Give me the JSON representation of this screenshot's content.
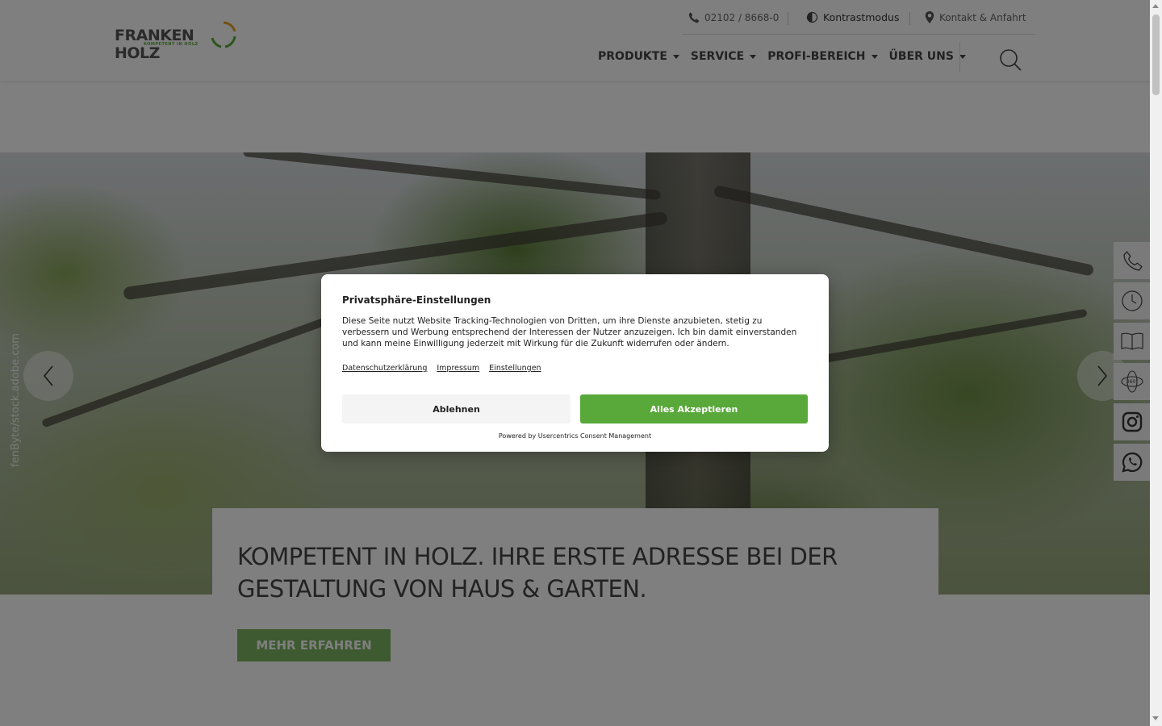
{
  "brand": {
    "name": "FRANKEN HOLZ",
    "tagline": "KOMPETENT IN HOLZ"
  },
  "topbar": {
    "phone": "02102 / 8668-0",
    "contrast": "Kontrastmodus",
    "contact": "Kontakt & Anfahrt"
  },
  "nav": {
    "items": [
      "PRODUKTE",
      "SERVICE",
      "PROFI-BEREICH",
      "ÜBER UNS"
    ]
  },
  "hero": {
    "photo_credit": "fenByte/stock.adobe.com",
    "headline": "KOMPETENT IN HOLZ. IHRE ERSTE ADRESSE BEI DER GESTALTUNG VON HAUS & GARTEN.",
    "cta": "MEHR ERFAHREN"
  },
  "side_icons": [
    "phone-icon",
    "clock-icon",
    "book-icon",
    "360-icon",
    "instagram-icon",
    "whatsapp-icon"
  ],
  "side_360_label": "360°",
  "consent": {
    "title": "Privatsphäre-Einstellungen",
    "text": "Diese Seite nutzt Website Tracking-Technologien von Dritten, um ihre Dienste anzubieten, stetig zu verbessern und Werbung entsprechend der Interessen der Nutzer anzuzeigen. Ich bin damit einverstanden und kann meine Einwilligung jederzeit mit Wirkung für die Zukunft widerrufen oder ändern.",
    "links": [
      "Datenschutzerklärung",
      "Impressum",
      "Einstellungen"
    ],
    "decline": "Ablehnen",
    "accept": "Alles Akzeptieren",
    "powered": "Powered by Usercentrics Consent Management"
  },
  "colors": {
    "accent": "#59a83a",
    "cta": "#7bb560",
    "text": "#444444"
  }
}
